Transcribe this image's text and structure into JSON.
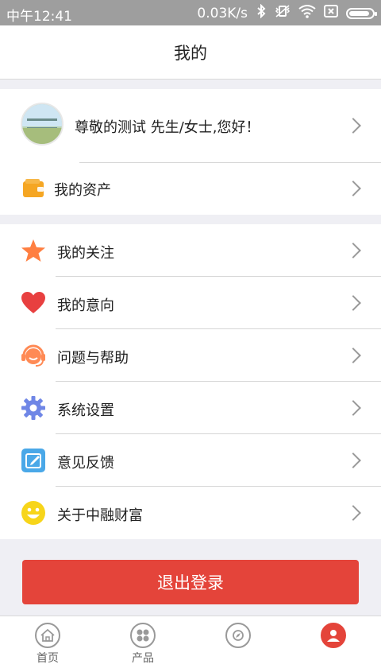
{
  "status_bar": {
    "time": "中午12:41",
    "speed": "0.03K/s",
    "battery_level": 0.9
  },
  "header": {
    "title": "我的"
  },
  "profile": {
    "greeting": "尊敬的测试 先生/女士,您好！"
  },
  "assets": {
    "label": "我的资产"
  },
  "menu": [
    {
      "label": "我的关注",
      "icon": "star-icon",
      "color": "#ff7f41"
    },
    {
      "label": "我的意向",
      "icon": "heart-icon",
      "color": "#e84040"
    },
    {
      "label": "问题与帮助",
      "icon": "headset-icon",
      "color": "#ff8a55"
    },
    {
      "label": "系统设置",
      "icon": "gear-icon",
      "color": "#6f86e6"
    },
    {
      "label": "意见反馈",
      "icon": "edit-icon",
      "color": "#4aa8e8"
    },
    {
      "label": "关于中融财富",
      "icon": "smiley-icon",
      "color": "#f7d51a"
    }
  ],
  "logout": {
    "label": "退出登录"
  },
  "tabs": [
    {
      "label": "首页",
      "icon": "home-icon"
    },
    {
      "label": "产品",
      "icon": "product-icon"
    },
    {
      "label": "",
      "icon": "discover-icon"
    },
    {
      "label": "",
      "icon": "user-icon"
    }
  ],
  "colors": {
    "accent": "#e4443a",
    "chevron": "#999999"
  }
}
